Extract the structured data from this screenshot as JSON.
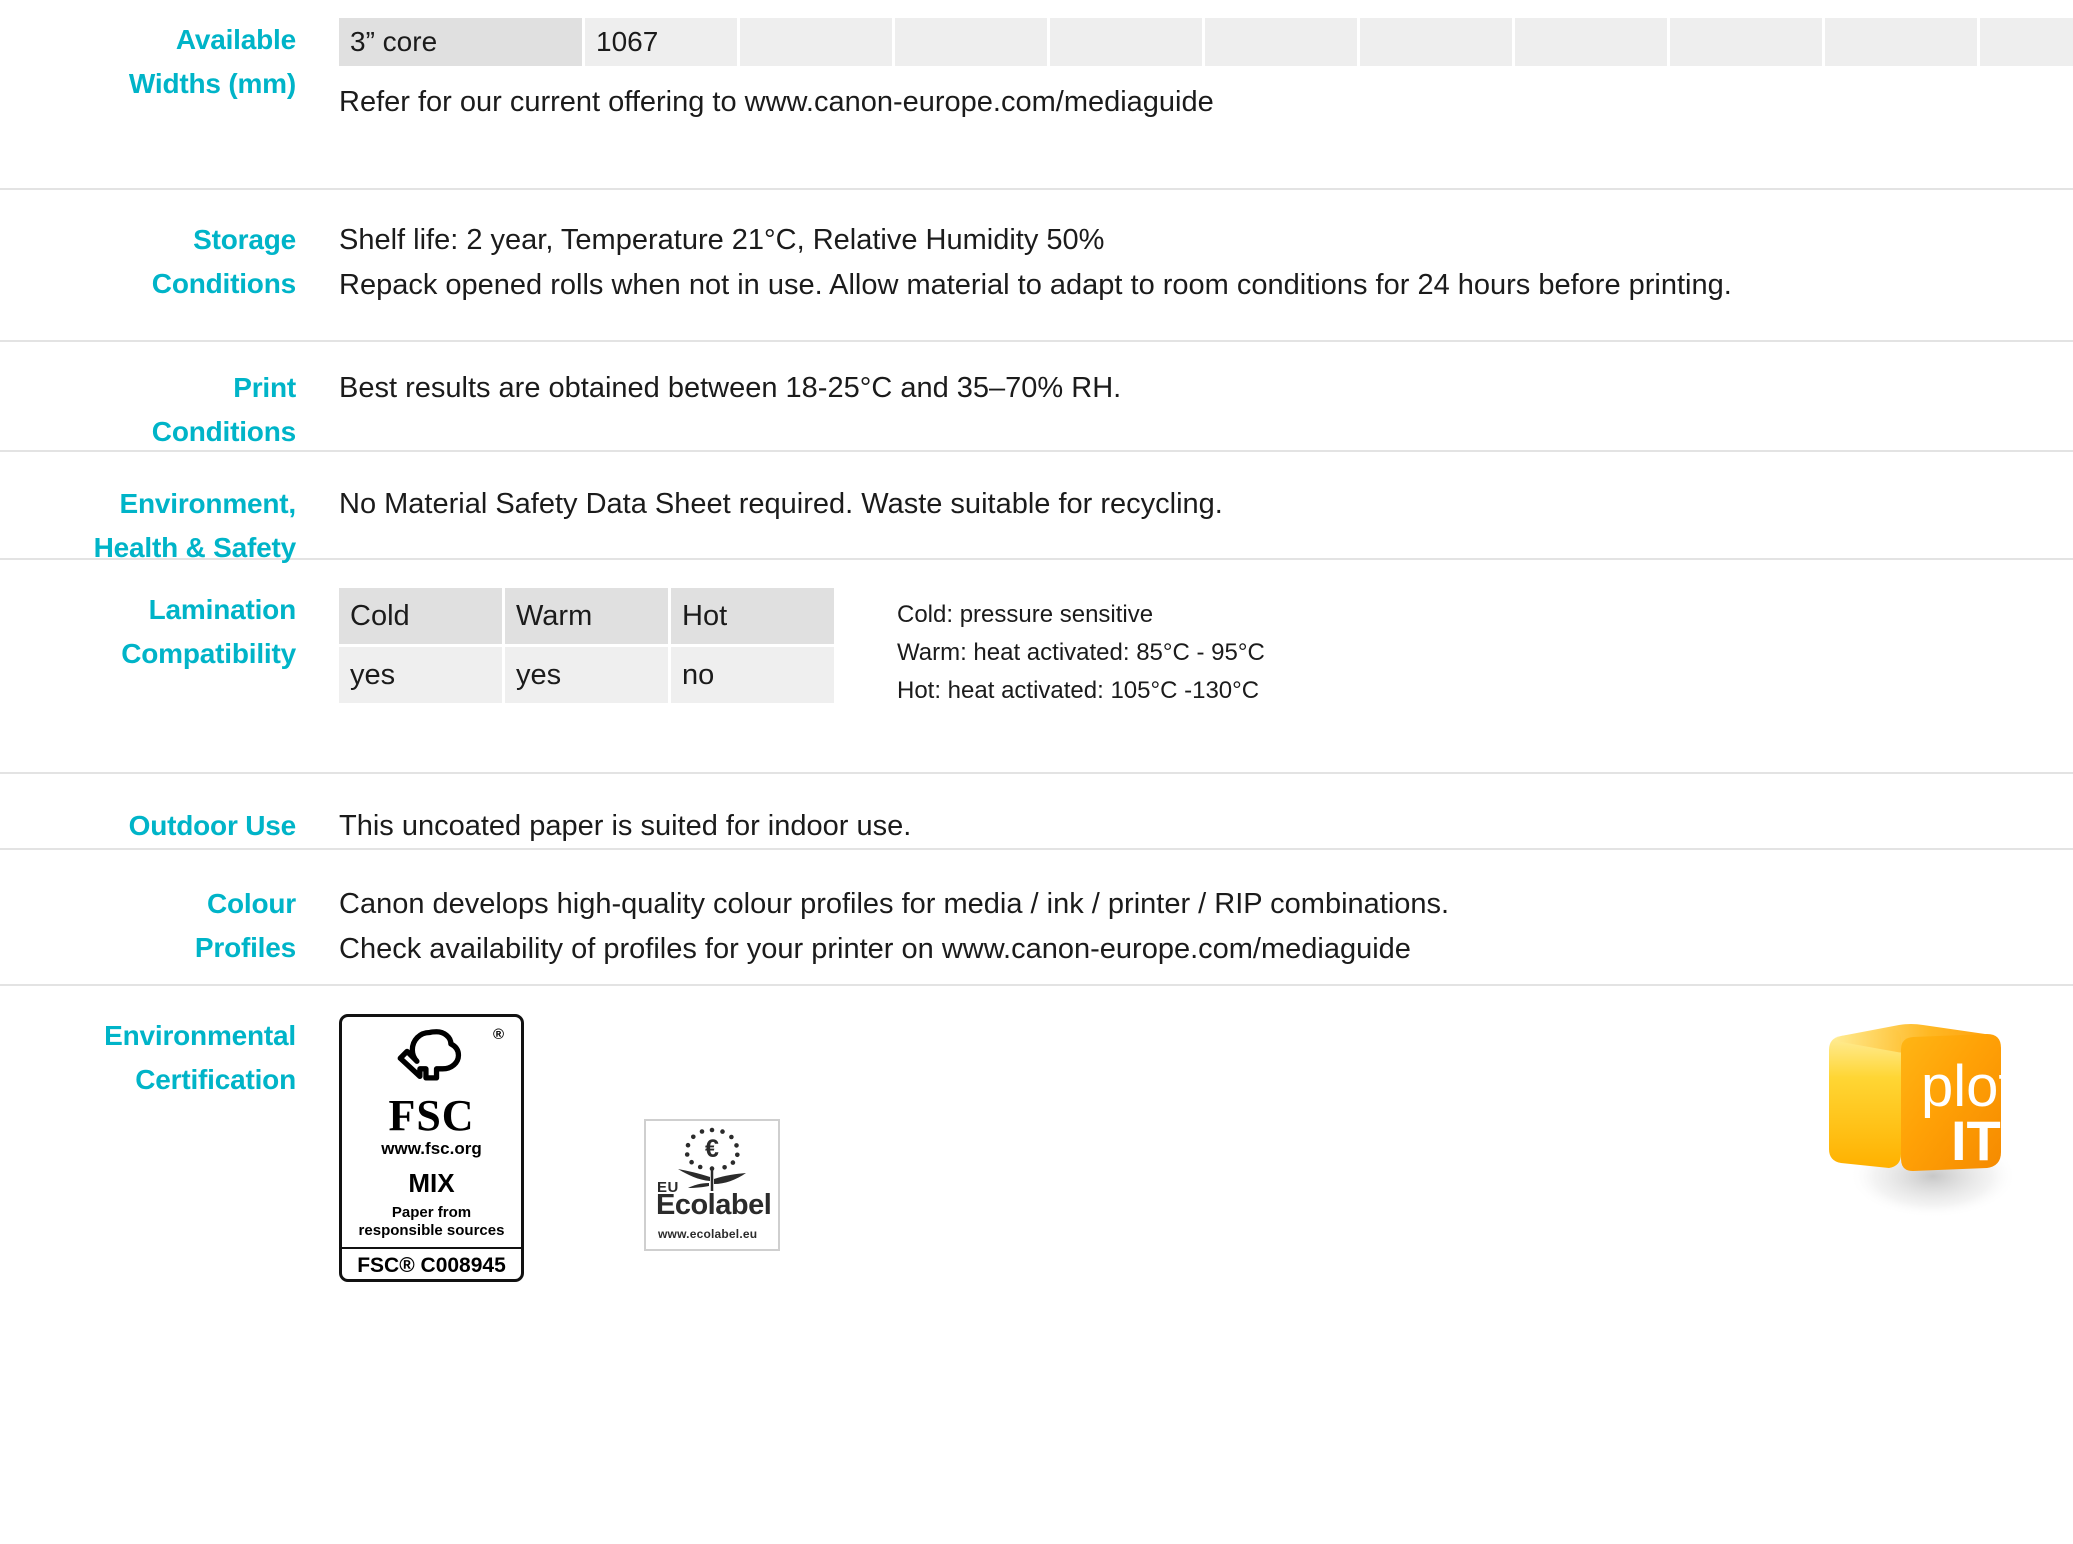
{
  "accent_color": "#00b4c8",
  "rows": [
    {
      "id": "available-widths",
      "label_line1": "Available",
      "label_line2": "Widths (mm)",
      "table": {
        "core": "3” core",
        "widths": [
          "1067"
        ],
        "empty_cells": 9
      },
      "note": "Refer for our current offering to www.canon-europe.com/mediaguide"
    },
    {
      "id": "storage-conditions",
      "label_line1": "Storage",
      "label_line2": "Conditions",
      "lines": [
        "Shelf life: 2 year, Temperature 21°C, Relative Humidity 50%",
        "Repack opened rolls when not in use. Allow material to adapt to room conditions for 24 hours before printing."
      ]
    },
    {
      "id": "print-conditions",
      "label_line1": "Print",
      "label_line2": "Conditions",
      "lines": [
        "Best results are obtained between 18-25°C and 35–70% RH."
      ]
    },
    {
      "id": "environment-health-safety",
      "label_line1": "Environment,",
      "label_line2": "Health & Safety",
      "lines": [
        "No Material Safety Data Sheet required. Waste suitable for recycling."
      ]
    },
    {
      "id": "lamination-compatibility",
      "label_line1": "Lamination",
      "label_line2": "Compatibility",
      "table": {
        "headers": [
          "Cold",
          "Warm",
          "Hot"
        ],
        "values": [
          "yes",
          "yes",
          "no"
        ]
      },
      "notes": [
        "Cold: pressure sensitive",
        "Warm: heat activated: 85°C - 95°C",
        "Hot: heat activated: 105°C -130°C"
      ]
    },
    {
      "id": "outdoor-use",
      "label_line1": "Outdoor Use",
      "label_line2": "",
      "lines": [
        "This uncoated paper is suited for indoor use."
      ]
    },
    {
      "id": "colour-profiles",
      "label_line1": "Colour",
      "label_line2": "Profiles",
      "lines": [
        "Canon develops high-quality colour profiles for media / ink / printer / RIP combinations.",
        "Check availability of profiles for your printer on www.canon-europe.com/mediaguide"
      ]
    },
    {
      "id": "environmental-certification",
      "label_line1": "Environmental",
      "label_line2": "Certification",
      "logos": {
        "fsc": {
          "word": "FSC",
          "url": "www.fsc.org",
          "grade": "MIX",
          "description_line1": "Paper from",
          "description_line2": "responsible sources",
          "code": "FSC® C008945",
          "registered_mark": "®"
        },
        "ecolabel": {
          "eu": "EU",
          "name": "Ecolabel",
          "url": "www.ecolabel.eu",
          "symbol": "€"
        },
        "plotit": {
          "line1": "plot",
          "line2": "IT",
          "color_light": "#ffd23d",
          "color_mid": "#ffa907",
          "color_dark": "#f08a00"
        }
      }
    }
  ]
}
